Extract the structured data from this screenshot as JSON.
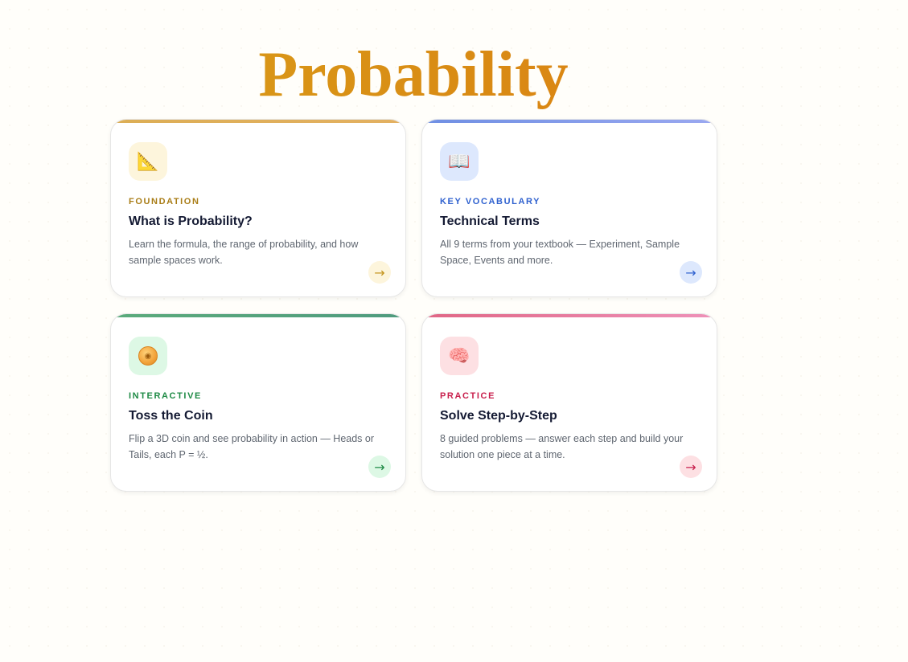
{
  "page": {
    "title": "Probability"
  },
  "cards": [
    {
      "eyebrow": "FOUNDATION",
      "title": "What is Probability?",
      "description": "Learn the formula, the range of probability, and how sample spaces work.",
      "icon": "triangular-ruler-icon",
      "icon_glyph": "📐",
      "arrow": "→",
      "accent": "#a97d17"
    },
    {
      "eyebrow": "KEY VOCABULARY",
      "title": "Technical Terms",
      "description": "All 9 terms from your textbook — Experiment, Sample Space, Events and more.",
      "icon": "open-book-icon",
      "icon_glyph": "📖",
      "arrow": "→",
      "accent": "#2f61cf"
    },
    {
      "eyebrow": "INTERACTIVE",
      "title": "Toss the Coin",
      "description": "Flip a 3D coin and see probability in action — Heads or Tails, each P = ½.",
      "icon": "coin-icon",
      "arrow": "→",
      "accent": "#1e8a45"
    },
    {
      "eyebrow": "PRACTICE",
      "title": "Solve Step-by-Step",
      "description": "8 guided problems — answer each step and build your solution one piece at a time.",
      "icon": "brain-icon",
      "icon_glyph": "🧠",
      "arrow": "→",
      "accent": "#c81f4c"
    }
  ]
}
